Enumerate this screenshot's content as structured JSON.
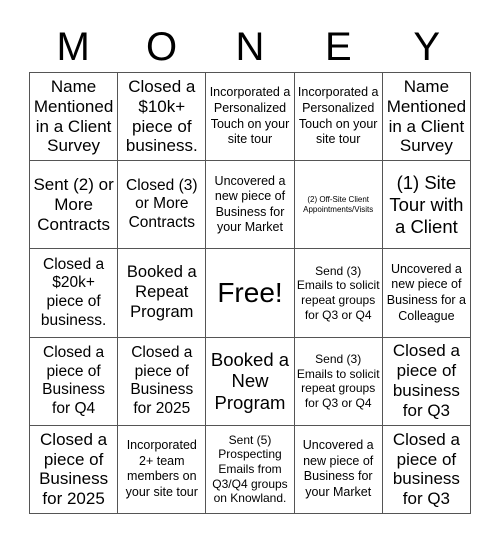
{
  "title_letters": [
    "M",
    "O",
    "N",
    "E",
    "Y"
  ],
  "cells": [
    [
      "Name Mentioned in a Client Survey",
      "Closed a $10k+ piece of business.",
      "Incorporated a Personalized Touch on your site tour",
      "Incorporated a Personalized Touch on your site tour",
      "Name Mentioned in a Client Survey"
    ],
    [
      "Sent (2) or More Contracts",
      "Closed (3) or More Contracts",
      "Uncovered a new piece of Business for your Market",
      "(2) Off-Site Client Appointments/Visits",
      "(1) Site Tour with a Client"
    ],
    [
      "Closed a $20k+ piece of business.",
      "Booked a Repeat Program",
      "Free!",
      "Send (3) Emails to solicit repeat groups for Q3 or Q4",
      "Uncovered a new piece of Business for a Colleague"
    ],
    [
      "Closed a piece of Business for Q4",
      "Closed a piece of Business for 2025",
      "Booked a New Program",
      "Send (3) Emails to solicit repeat groups for Q3 or Q4",
      "Closed a piece of business for Q3"
    ],
    [
      "Closed a piece of Business for 2025",
      "Incorporated 2+ team members on your site tour",
      "Sent (5) Prospecting Emails from Q3/Q4 groups on Knowland.",
      "Uncovered a new piece of Business for your Market",
      "Closed a piece of business for Q3"
    ]
  ]
}
